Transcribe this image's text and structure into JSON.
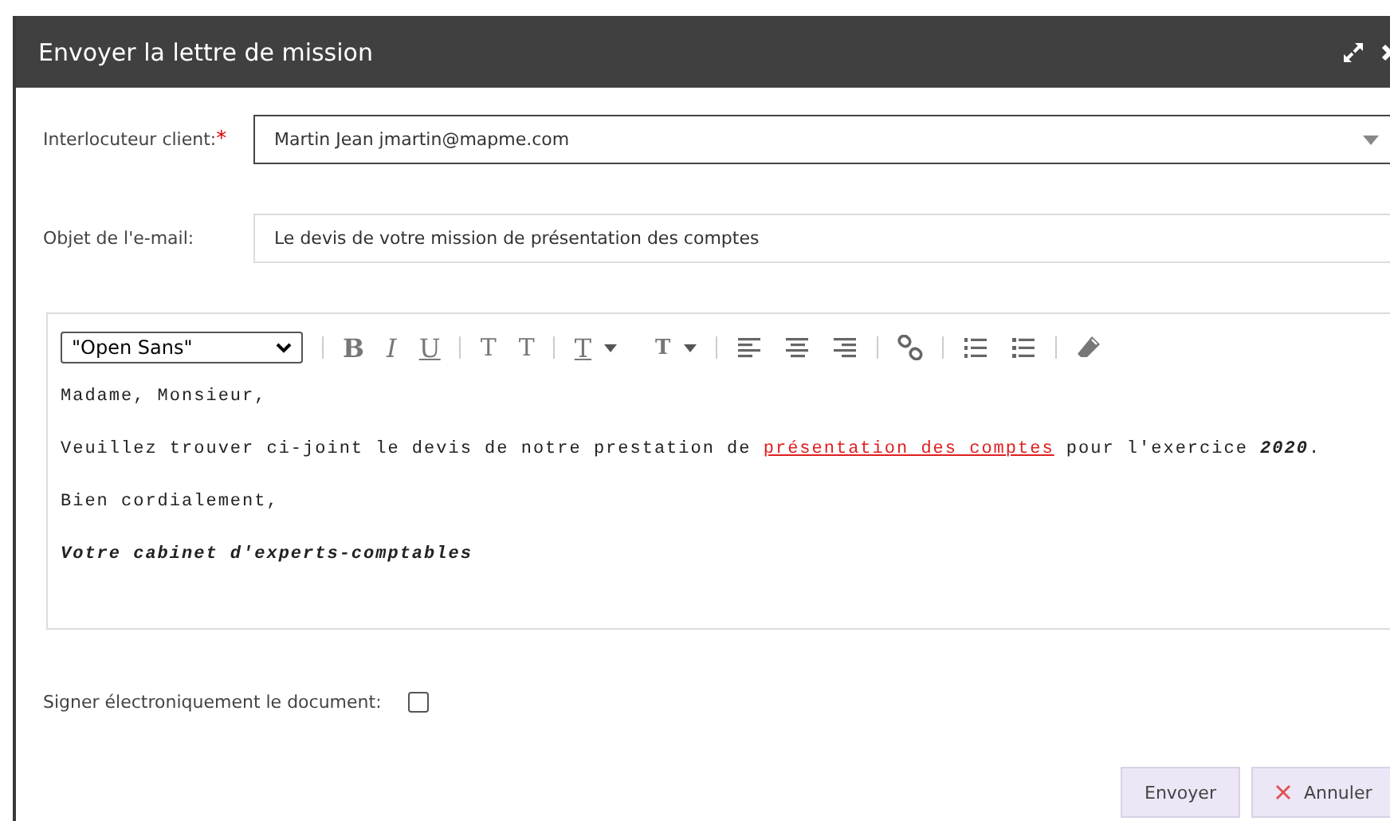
{
  "window": {
    "title": "Envoyer la lettre de mission"
  },
  "fields": [
    {
      "label": "Interlocuteur client:",
      "required_mark": "*",
      "kind": "select",
      "value": "Martin Jean jmartin@mapme.com"
    },
    {
      "label": "Objet de l'e-mail:",
      "kind": "text",
      "value": "Le devis de votre mission de présentation des comptes"
    }
  ],
  "editor": {
    "font": "\"Open Sans\"",
    "toolbar": [
      {
        "kind": "sep"
      },
      {
        "kind": "bold",
        "glyph": "B"
      },
      {
        "kind": "italic",
        "glyph": "I"
      },
      {
        "kind": "underline",
        "glyph": "U"
      },
      {
        "kind": "sep"
      },
      {
        "kind": "superscript",
        "glyph": "T"
      },
      {
        "kind": "subscript",
        "glyph": "T"
      },
      {
        "kind": "sep"
      },
      {
        "kind": "text-color",
        "glyph": "T"
      },
      {
        "kind": "highlight",
        "glyph": "T"
      },
      {
        "kind": "sep"
      },
      {
        "kind": "align-left"
      },
      {
        "kind": "align-center"
      },
      {
        "kind": "align-right"
      },
      {
        "kind": "sep"
      },
      {
        "kind": "link"
      },
      {
        "kind": "sep"
      },
      {
        "kind": "ordered-list"
      },
      {
        "kind": "bullet-list"
      },
      {
        "kind": "sep"
      },
      {
        "kind": "clear"
      }
    ],
    "paragraphs": [
      {
        "emphasis": false,
        "parts": [
          {
            "kind": "plain",
            "text": "Madame, Monsieur,"
          }
        ]
      },
      {
        "emphasis": false,
        "parts": [
          {
            "kind": "plain",
            "text": "Veuillez trouver ci-joint le devis de notre prestation de "
          },
          {
            "kind": "link",
            "text": "présentation des comptes"
          },
          {
            "kind": "plain",
            "text": " pour l'exercice "
          },
          {
            "kind": "emph",
            "text": "2020"
          },
          {
            "kind": "plain",
            "text": "."
          }
        ]
      },
      {
        "emphasis": false,
        "parts": [
          {
            "kind": "plain",
            "text": "Bien cordialement,"
          }
        ]
      },
      {
        "emphasis": true,
        "parts": [
          {
            "kind": "plain",
            "text": "Votre cabinet d'experts-comptables"
          }
        ]
      }
    ]
  },
  "signature": {
    "label": "Signer électroniquement le document:",
    "checked": false
  },
  "buttons": [
    {
      "label": "Envoyer",
      "kind": "send"
    },
    {
      "label": "Annuler",
      "kind": "cancel"
    }
  ]
}
